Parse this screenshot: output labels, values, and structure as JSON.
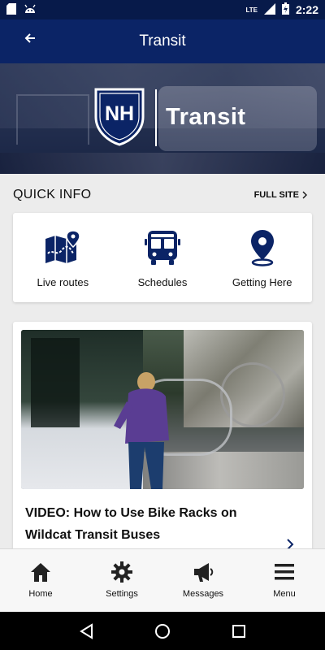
{
  "status_bar": {
    "network": "LTE",
    "time": "2:22"
  },
  "app_bar": {
    "title": "Transit"
  },
  "hero": {
    "logo_letters": "NH",
    "logo_text": "Transit"
  },
  "quick_info": {
    "heading": "QUICK INFO",
    "full_site": "FULL SITE",
    "items": [
      {
        "label": "Live routes",
        "icon": "map-pin-icon"
      },
      {
        "label": "Schedules",
        "icon": "bus-icon"
      },
      {
        "label": "Getting Here",
        "icon": "location-pin-icon"
      }
    ]
  },
  "news": {
    "title": "VIDEO: How to Use Bike Racks on Wildcat Transit Buses"
  },
  "bottom_nav": [
    {
      "label": "Home",
      "icon": "home-icon"
    },
    {
      "label": "Settings",
      "icon": "gear-icon"
    },
    {
      "label": "Messages",
      "icon": "megaphone-icon"
    },
    {
      "label": "Menu",
      "icon": "menu-icon"
    }
  ],
  "colors": {
    "primary_navy": "#0b2466",
    "status_navy": "#071a4a",
    "icon_navy": "#0b2466"
  }
}
